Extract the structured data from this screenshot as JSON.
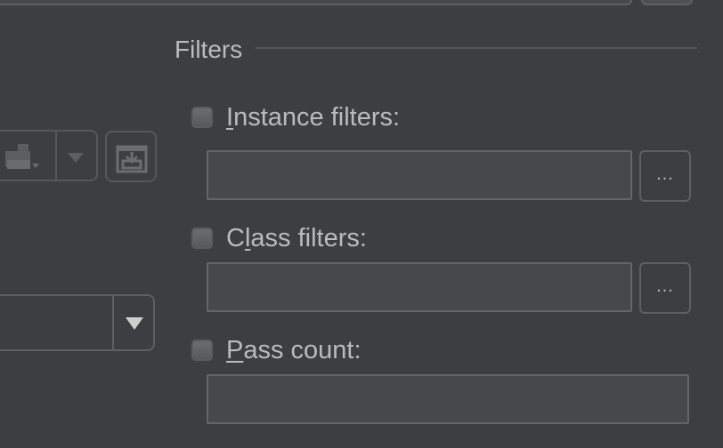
{
  "filters": {
    "title": "Filters",
    "instance": {
      "mnemonic": "I",
      "label_rest": "nstance filters:",
      "checked": false,
      "value": "",
      "browse_label": "..."
    },
    "class": {
      "label_pre": "C",
      "mnemonic": "l",
      "label_rest": "ass filters:",
      "checked": false,
      "value": "",
      "browse_label": "..."
    },
    "pass_count": {
      "mnemonic": "P",
      "label_rest": "ass count:",
      "checked": false,
      "value": ""
    }
  },
  "icons": {
    "left_combo": "disabled-document-icon",
    "left_combo_arrow": "chevron-down-icon",
    "add_button": "import-icon",
    "dropdown_arrow": "chevron-down-icon"
  },
  "colors": {
    "background": "#3c3f41",
    "text": "#bbbbbb",
    "border": "#5e6060",
    "field_background": "#45494a"
  }
}
